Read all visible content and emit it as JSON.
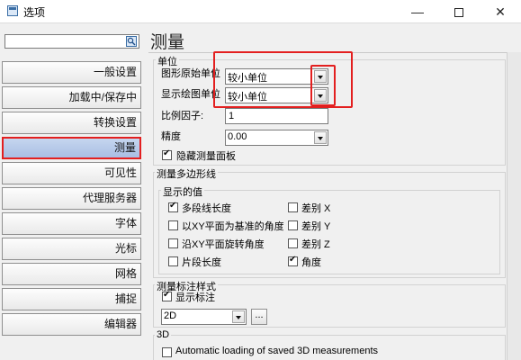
{
  "window": {
    "title": "选项",
    "minimize": "—",
    "close": "✕"
  },
  "search": {
    "value": "",
    "placeholder": ""
  },
  "nav": [
    {
      "label": "一般设置",
      "active": false
    },
    {
      "label": "加载中/保存中",
      "active": false
    },
    {
      "label": "转换设置",
      "active": false
    },
    {
      "label": "测量",
      "active": true
    },
    {
      "label": "可见性",
      "active": false
    },
    {
      "label": "代理服务器",
      "active": false
    },
    {
      "label": "字体",
      "active": false
    },
    {
      "label": "光标",
      "active": false
    },
    {
      "label": "网格",
      "active": false
    },
    {
      "label": "捕捉",
      "active": false
    },
    {
      "label": "编辑器",
      "active": false
    }
  ],
  "page": {
    "title": "测量"
  },
  "units": {
    "group_label": "单位",
    "shape_unit_label": "图形原始单位",
    "shape_unit_value": "较小单位",
    "display_unit_label": "显示绘图单位",
    "display_unit_value": "较小单位",
    "scale_label": "比例因子:",
    "scale_value": "1",
    "precision_label": "精度",
    "precision_value": "0.00",
    "hide_panel_label": "隐藏测量面板",
    "hide_panel_checked": true
  },
  "polyline": {
    "group_label": "测量多边形线",
    "display_group_label": "显示的值",
    "items": [
      {
        "label": "多段线长度",
        "checked": true
      },
      {
        "label": "以XY平面为基准的角度",
        "checked": false
      },
      {
        "label": "沿XY平面旋转角度",
        "checked": false
      },
      {
        "label": "片段长度",
        "checked": false
      }
    ],
    "items_right": [
      {
        "label": "差别 X",
        "checked": false
      },
      {
        "label": "差别 Y",
        "checked": false
      },
      {
        "label": "差别 Z",
        "checked": false
      },
      {
        "label": "角度",
        "checked": true
      }
    ]
  },
  "annotation": {
    "group_label": "测量标注样式",
    "show_label": "显示标注",
    "show_checked": true,
    "style_value": "2D",
    "more_button": "..."
  },
  "three_d": {
    "group_label": "3D",
    "auto_load_label": "Automatic loading of saved 3D measurements",
    "auto_load_checked": false
  },
  "colors": {
    "highlight": "#e31f1f",
    "active_nav": "#b5c8e8"
  }
}
